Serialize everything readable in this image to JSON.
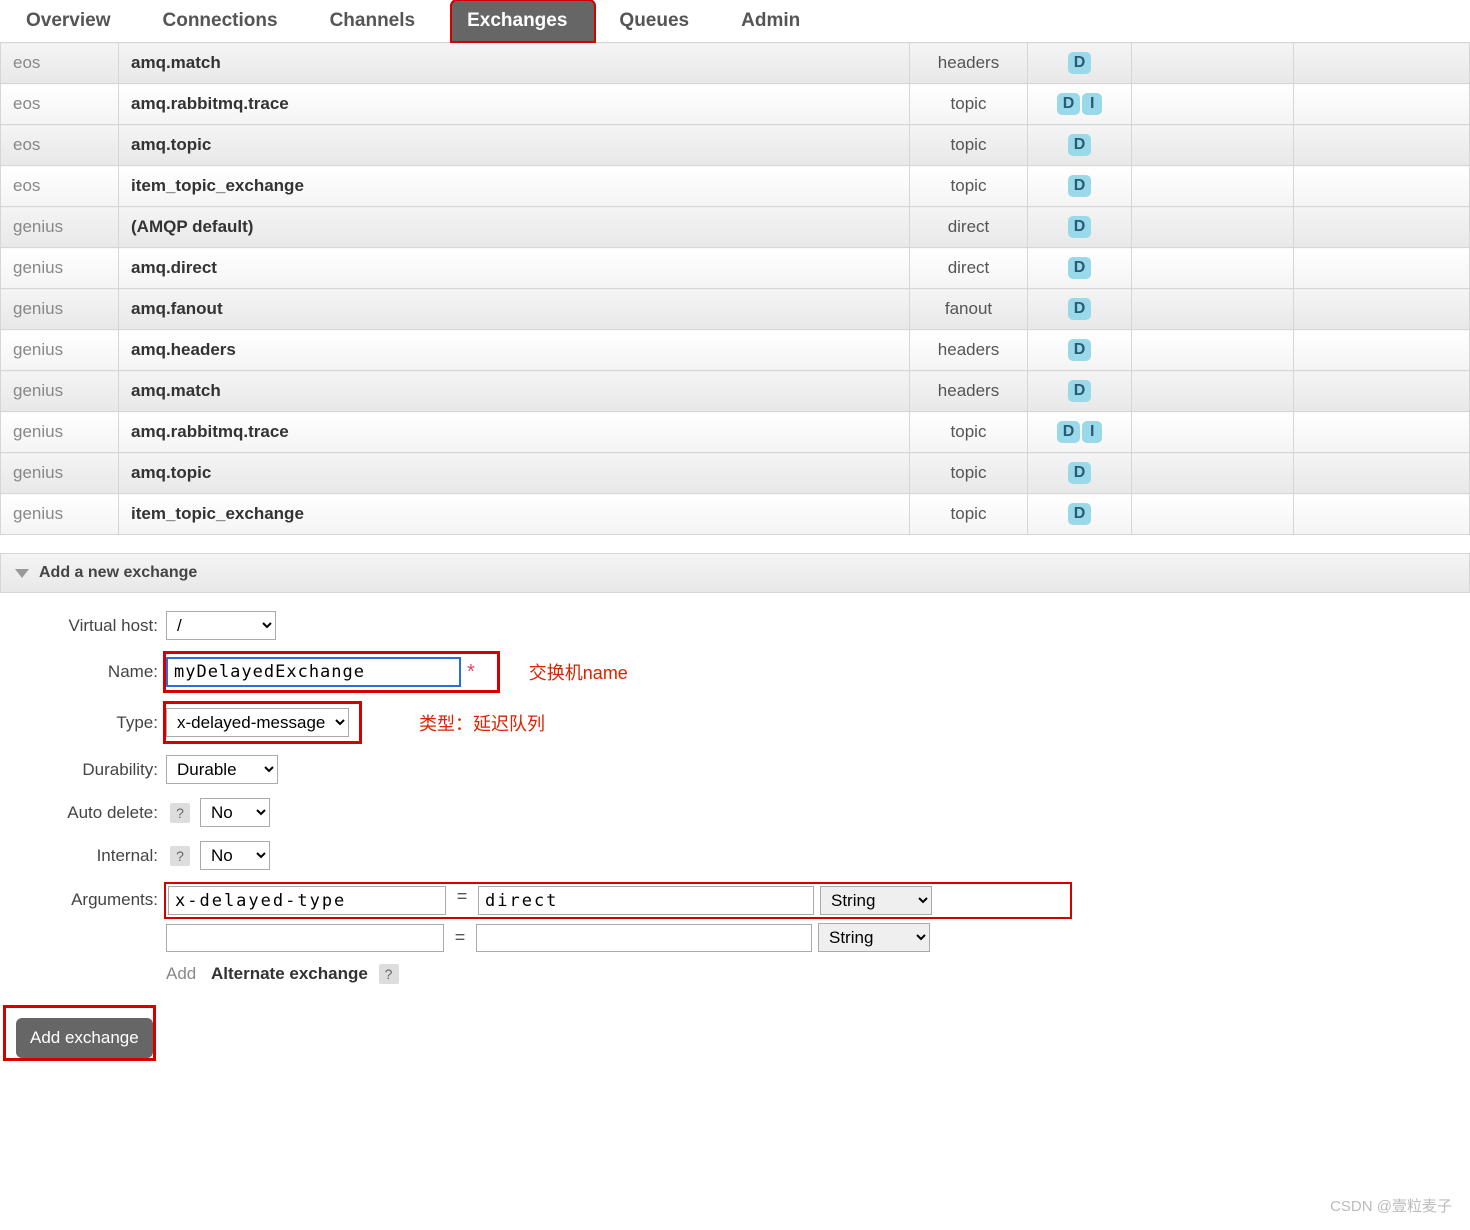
{
  "nav": {
    "items": [
      "Overview",
      "Connections",
      "Channels",
      "Exchanges",
      "Queues",
      "Admin"
    ],
    "activeIndex": 3
  },
  "table": {
    "rows": [
      {
        "vh": "eos",
        "name": "amq.match",
        "type": "headers",
        "feat": [
          "D"
        ]
      },
      {
        "vh": "eos",
        "name": "amq.rabbitmq.trace",
        "type": "topic",
        "feat": [
          "D",
          "I"
        ]
      },
      {
        "vh": "eos",
        "name": "amq.topic",
        "type": "topic",
        "feat": [
          "D"
        ]
      },
      {
        "vh": "eos",
        "name": "item_topic_exchange",
        "type": "topic",
        "feat": [
          "D"
        ]
      },
      {
        "vh": "genius",
        "name": "(AMQP default)",
        "type": "direct",
        "feat": [
          "D"
        ]
      },
      {
        "vh": "genius",
        "name": "amq.direct",
        "type": "direct",
        "feat": [
          "D"
        ]
      },
      {
        "vh": "genius",
        "name": "amq.fanout",
        "type": "fanout",
        "feat": [
          "D"
        ]
      },
      {
        "vh": "genius",
        "name": "amq.headers",
        "type": "headers",
        "feat": [
          "D"
        ]
      },
      {
        "vh": "genius",
        "name": "amq.match",
        "type": "headers",
        "feat": [
          "D"
        ]
      },
      {
        "vh": "genius",
        "name": "amq.rabbitmq.trace",
        "type": "topic",
        "feat": [
          "D",
          "I"
        ]
      },
      {
        "vh": "genius",
        "name": "amq.topic",
        "type": "topic",
        "feat": [
          "D"
        ]
      },
      {
        "vh": "genius",
        "name": "item_topic_exchange",
        "type": "topic",
        "feat": [
          "D"
        ]
      }
    ]
  },
  "section": {
    "title": "Add a new exchange"
  },
  "form": {
    "vhost_label": "Virtual host:",
    "vhost_value": "/",
    "name_label": "Name:",
    "name_value": "myDelayedExchange",
    "name_star": "*",
    "type_label": "Type:",
    "type_value": "x-delayed-message",
    "durability_label": "Durability:",
    "durability_value": "Durable",
    "autodelete_label": "Auto delete:",
    "autodelete_help": "?",
    "autodelete_value": "No",
    "internal_label": "Internal:",
    "internal_help": "?",
    "internal_value": "No",
    "arguments_label": "Arguments:",
    "args": [
      {
        "key": "x-delayed-type",
        "val": "direct",
        "type": "String"
      },
      {
        "key": "",
        "val": "",
        "type": "String"
      }
    ],
    "add_hint": "Add",
    "alt_exchange": "Alternate exchange",
    "alt_help": "?",
    "submit": "Add exchange"
  },
  "annotations": {
    "name": "交换机name",
    "type": "类型：延迟队列"
  },
  "watermark": "CSDN @壹粒麦子"
}
